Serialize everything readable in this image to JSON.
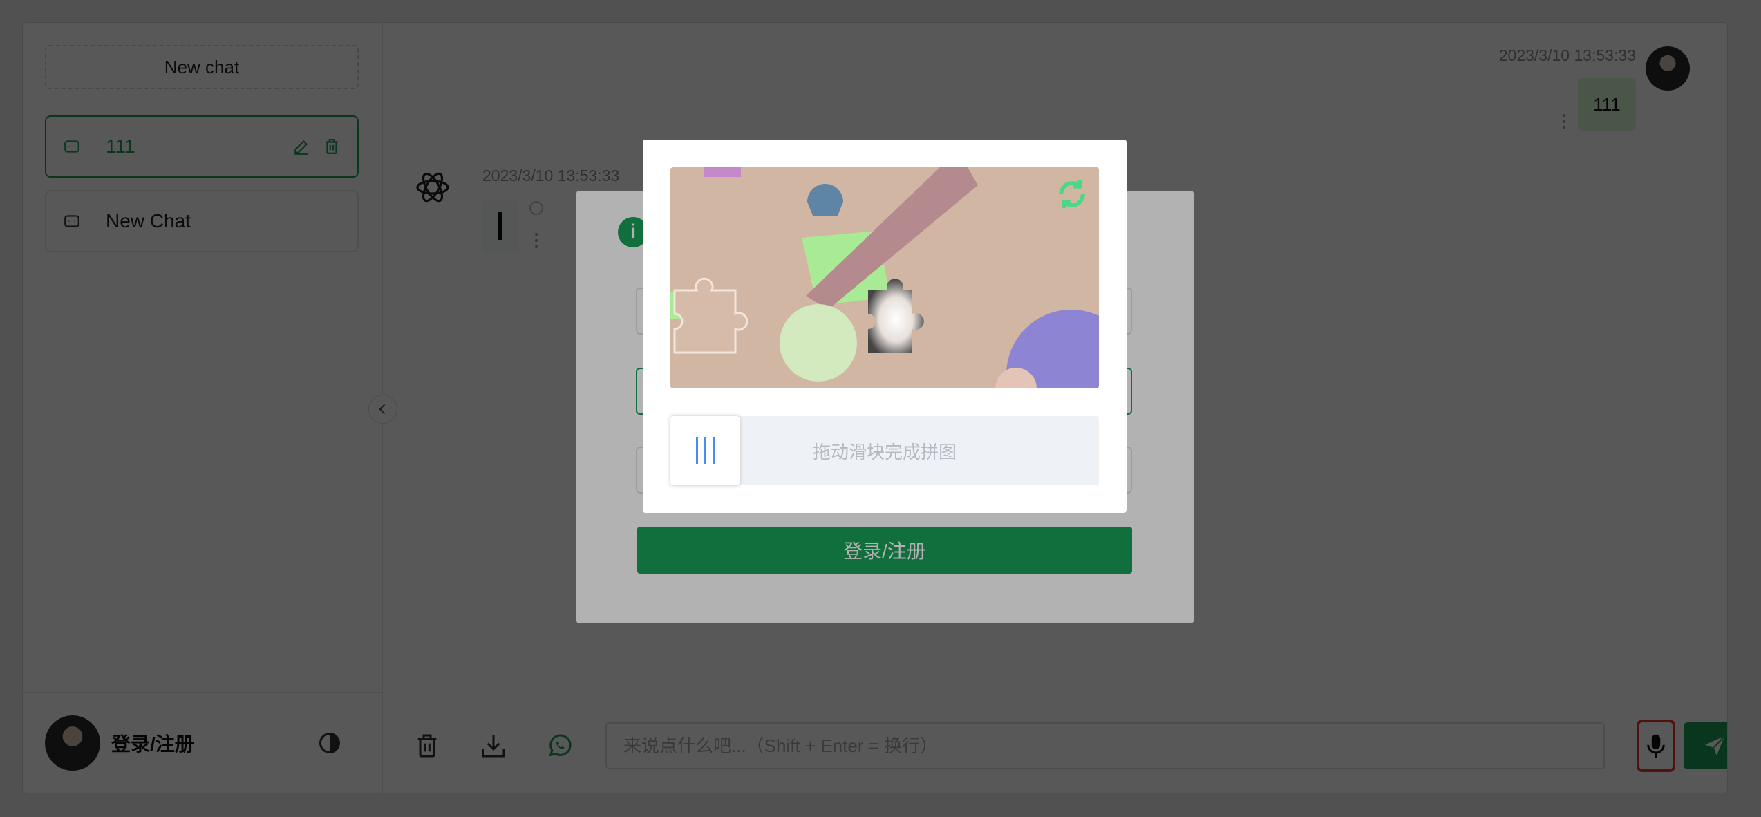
{
  "sidebar": {
    "new_chat_label": "New chat",
    "conversations": [
      {
        "title": "111",
        "active": true
      },
      {
        "title": "New Chat",
        "active": false
      }
    ],
    "footer": {
      "user_label": "登录/注册"
    }
  },
  "chat": {
    "messages": [
      {
        "role": "user",
        "time": "2023/3/10 13:53:33",
        "text": "111"
      },
      {
        "role": "assistant",
        "time": "2023/3/10 13:53:33",
        "text": ""
      }
    ],
    "input_placeholder": "来说点什么吧...（Shift + Enter = 换行）"
  },
  "login_modal": {
    "submit_label": "登录/注册"
  },
  "captcha": {
    "slider_hint": "拖动滑块完成拼图"
  },
  "colors": {
    "accent": "#18a058",
    "highlight": "#e23b2e",
    "captcha_bg": "#d1b6a3",
    "slider_handle": "#4a8cf0"
  },
  "icons": [
    "chat-icon",
    "edit-icon",
    "trash-icon",
    "theme-icon",
    "chevron-left-icon",
    "openai-icon",
    "download-icon",
    "whatsapp-icon",
    "microphone-icon",
    "send-icon",
    "refresh-icon",
    "info-icon",
    "puzzle-piece-icon"
  ]
}
